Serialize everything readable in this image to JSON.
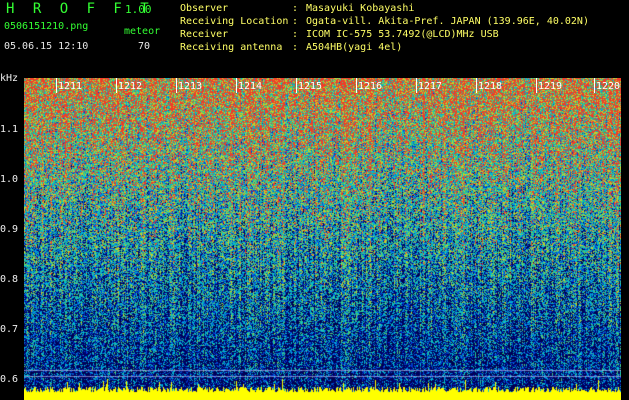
{
  "header": {
    "app_title": "H R O F F T",
    "version": "1.00",
    "filename": "0506151210.png",
    "mode": "meteor",
    "datetime": "05.06.15 12:10",
    "count": "70"
  },
  "info": [
    {
      "key": "Observer",
      "value": "Masayuki Kobayashi"
    },
    {
      "key": "Receiving Location",
      "value": "Ogata-vill. Akita-Pref. JAPAN (139.96E, 40.02N)"
    },
    {
      "key": "Receiver",
      "value": "ICOM IC-575 53.7492(@LCD)MHz USB"
    },
    {
      "key": "Receiving antenna",
      "value": "A504HB(yagi 4el)"
    }
  ],
  "colon": ":",
  "y_axis": {
    "unit": "kHz",
    "labels": [
      "1.1",
      "1.0",
      "0.9",
      "0.8",
      "0.7",
      "0.6"
    ]
  },
  "time_ticks": [
    "1211",
    "1212",
    "1213",
    "1214",
    "1215",
    "1216",
    "1217",
    "1218",
    "1219",
    "1220"
  ],
  "colors": {
    "title_green": "#33ff33",
    "info_yellow": "#ffff66",
    "meteor_echo": "#ffff00"
  }
}
